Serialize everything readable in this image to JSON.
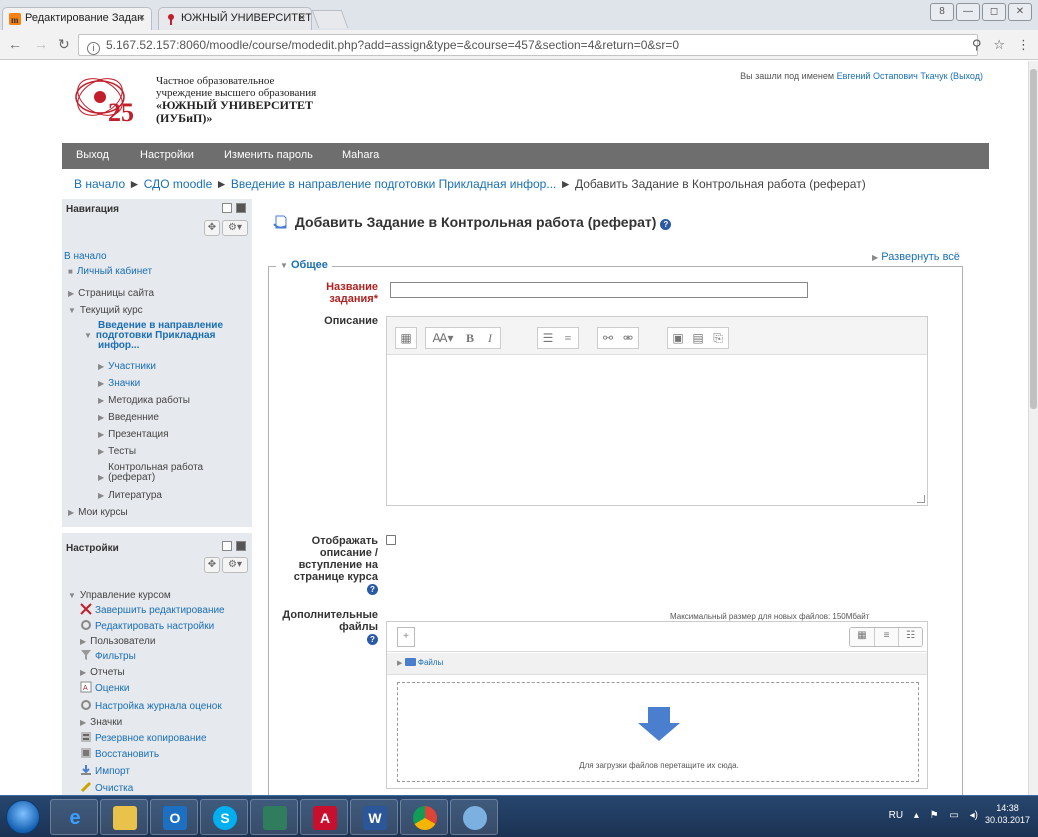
{
  "browser": {
    "tabs": [
      {
        "title": "Редактирование Задан"
      },
      {
        "title": "ЮЖНЫЙ УНИВЕРСИТЕТ"
      }
    ],
    "tab_close": "×",
    "url": "5.167.52.157:8060/moodle/course/modedit.php?add=assign&type=&course=457&section=4&return=0&sr=0",
    "window_buttons": [
      "8",
      "—",
      "◻",
      "✕"
    ]
  },
  "header": {
    "logo_number": "25",
    "org_line1": "Частное образовательное",
    "org_line2": "учреждение высшего образования",
    "org_line3": "«ЮЖНЫЙ УНИВЕРСИТЕТ",
    "org_line4": "(ИУБиП)»",
    "login_prefix": "Вы зашли под именем",
    "login_user": "Евгений Остапович Ткачук",
    "logout": "(Выход)"
  },
  "menu": [
    "Выход",
    "Настройки",
    "Изменить пароль",
    "Mahara"
  ],
  "breadcrumb": {
    "items": [
      "В начало",
      "СДО moodle",
      "Введение в направление подготовки Прикладная инфор...",
      "Добавить Задание в Контрольная работа (реферат)"
    ],
    "separator": "►"
  },
  "navigation": {
    "title": "Навигация",
    "home": "В начало",
    "items": [
      "Личный кабинет",
      "Страницы сайта",
      "Текущий курс"
    ],
    "course_lines": [
      "Введение в направление",
      "подготовки Прикладная",
      "инфор..."
    ],
    "course_items": [
      "Участники",
      "Значки",
      "Методика работы",
      "Введенние",
      "Презентация",
      "Тесты",
      "Контрольная работа",
      "(реферат)",
      "Литература"
    ],
    "my_courses": "Мои курсы"
  },
  "settings": {
    "title": "Настройки",
    "section": "Управление курсом",
    "items": [
      "Завершить редактирование",
      "Редактировать настройки",
      "Пользователи",
      "Фильтры",
      "Отчеты",
      "Оценки",
      "Настройка журнала оценок",
      "Значки",
      "Резервное копирование",
      "Восстановить",
      "Импорт",
      "Очистка"
    ]
  },
  "main": {
    "title": "Добавить Задание в Контрольная работа (реферат)",
    "expand_all": "Развернуть всё",
    "legend": "Общее",
    "name_label_1": "Название",
    "name_label_2": "задания",
    "required_mark": "*",
    "description_label": "Описание",
    "show_desc_lines": [
      "Отображать",
      "описание /",
      "вступление на",
      "странице курса"
    ],
    "files_lines": [
      "Дополнительные",
      "файлы"
    ],
    "max_size": "Максимальный размер для новых файлов: 150Мбайт",
    "files_folder": "Файлы",
    "drop_text": "Для загрузки файлов перетащите их сюда."
  },
  "taskbar": {
    "lang": "RU",
    "time": "14:38",
    "date": "30.03.2017"
  },
  "colors": {
    "link": "#1a6fb5",
    "menu_bg": "#6e6e6e",
    "block_bg": "#e6e9ed",
    "required": "#b32222",
    "drop_arrow": "#4a7fd0"
  }
}
